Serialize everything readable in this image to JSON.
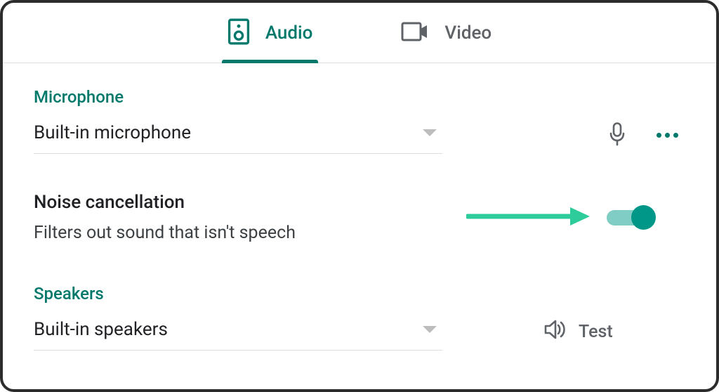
{
  "tabs": {
    "audio": {
      "label": "Audio"
    },
    "video": {
      "label": "Video"
    }
  },
  "microphone": {
    "section_label": "Microphone",
    "selected": "Built-in microphone"
  },
  "noise": {
    "title": "Noise cancellation",
    "description": "Filters out sound that isn't speech",
    "enabled": true
  },
  "speakers": {
    "section_label": "Speakers",
    "selected": "Built-in speakers",
    "test_label": "Test"
  },
  "colors": {
    "accent": "#00796b",
    "toggle": "#009688",
    "arrow": "#2ecc9b"
  }
}
